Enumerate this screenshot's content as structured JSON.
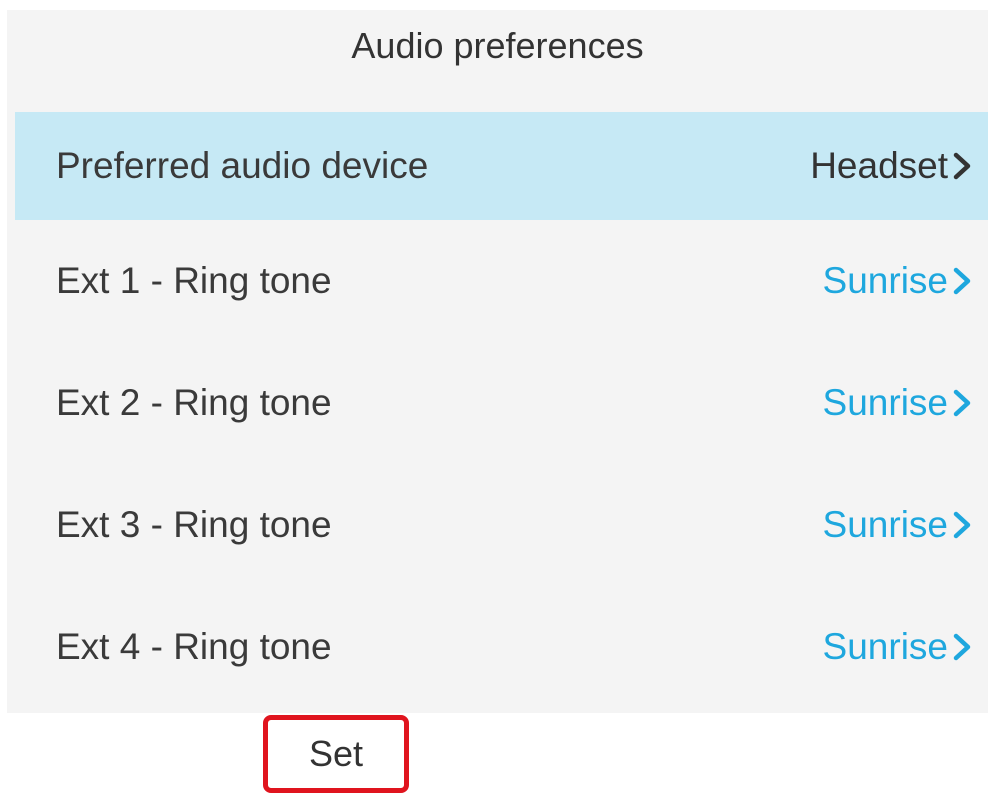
{
  "screen": {
    "title": "Audio preferences"
  },
  "rows": [
    {
      "label": "Preferred audio device",
      "value": "Headset",
      "selected": true
    },
    {
      "label": "Ext 1 - Ring tone",
      "value": "Sunrise",
      "selected": false
    },
    {
      "label": "Ext 2 - Ring tone",
      "value": "Sunrise",
      "selected": false
    },
    {
      "label": "Ext 3 - Ring tone",
      "value": "Sunrise",
      "selected": false
    },
    {
      "label": "Ext 4 - Ring tone",
      "value": "Sunrise",
      "selected": false
    }
  ],
  "softkeys": {
    "set_label": "Set"
  },
  "colors": {
    "selected_row": "#c6e9f5",
    "accent_value": "#1ea7de",
    "highlight_border": "#e0141e"
  },
  "icons": {
    "row_chevron": "chevron-right-icon"
  }
}
